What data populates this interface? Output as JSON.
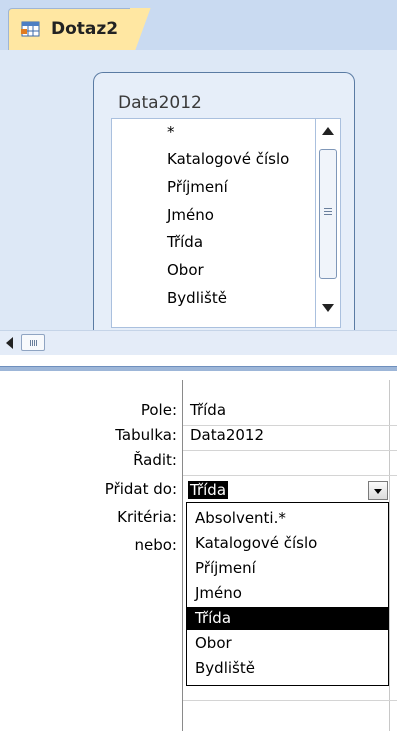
{
  "tab": {
    "label": "Dotaz2",
    "icon": "query-icon"
  },
  "table_box": {
    "title": "Data2012",
    "fields": [
      "*",
      "Katalogové číslo",
      "Příjmení",
      "Jméno",
      "Třída",
      "Obor",
      "Bydliště"
    ]
  },
  "grid": {
    "row_labels": {
      "field": "Pole:",
      "table": "Tabulka:",
      "sort": "Řadit:",
      "append_to": "Přidat do:",
      "criteria": "Kritéria:",
      "or": "nebo:"
    },
    "field_value": "Třída",
    "table_value": "Data2012",
    "append_to_value": "Třída",
    "append_options": [
      "Absolventi.*",
      "Katalogové číslo",
      "Příjmení",
      "Jméno",
      "Třída",
      "Obor",
      "Bydliště"
    ],
    "append_selected": "Třída"
  }
}
